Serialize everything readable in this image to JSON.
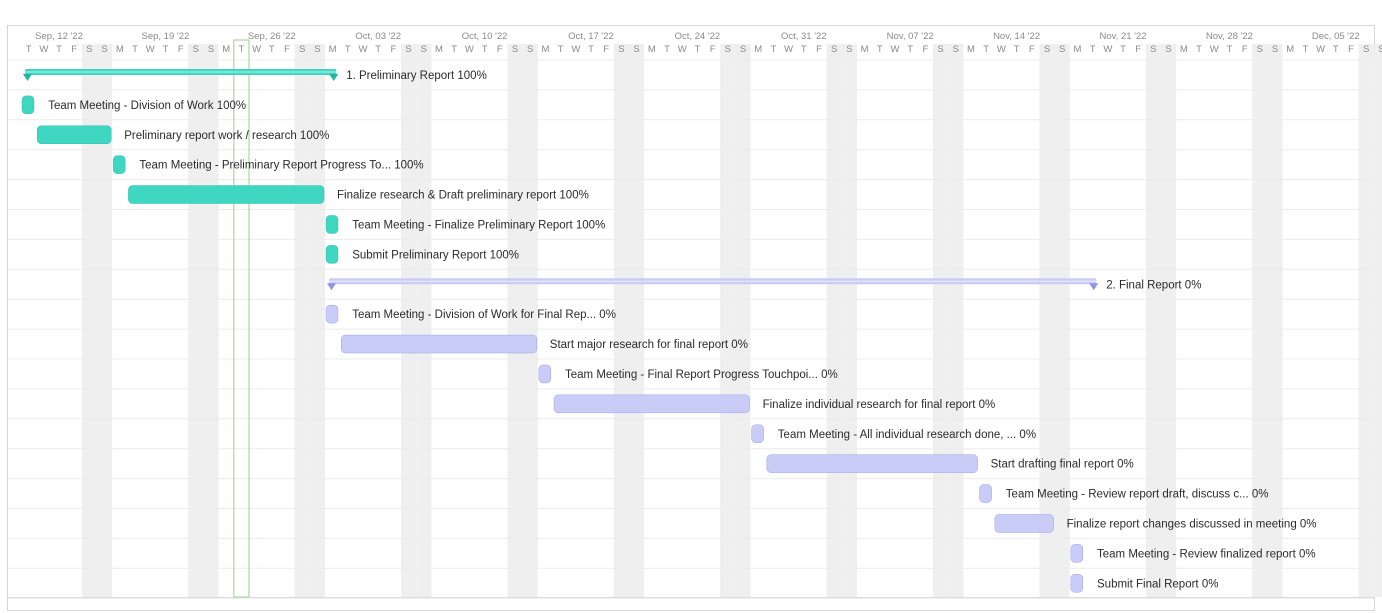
{
  "chart_data": {
    "type": "gantt",
    "x_axis": {
      "start": "2022-09-13",
      "end": "2022-12-11",
      "week_ticks": [
        "Sep, 12 '22",
        "Sep, 19 '22",
        "Sep, 26 '22",
        "Oct, 03 '22",
        "Oct, 10 '22",
        "Oct, 17 '22",
        "Oct, 24 '22",
        "Oct, 31 '22",
        "Nov, 07 '22",
        "Nov, 14 '22",
        "Nov, 21 '22",
        "Nov, 28 '22",
        "Dec, 05 '22"
      ],
      "week_tick_dates": [
        "2022-09-12",
        "2022-09-19",
        "2022-09-26",
        "2022-10-03",
        "2022-10-10",
        "2022-10-17",
        "2022-10-24",
        "2022-10-31",
        "2022-11-07",
        "2022-11-14",
        "2022-11-21",
        "2022-11-28",
        "2022-12-05"
      ],
      "day_letters": [
        "M",
        "T",
        "W",
        "T",
        "F",
        "S",
        "S"
      ],
      "today": "2022-09-27"
    },
    "colors": {
      "preliminary": "#3fd6c2",
      "preliminary_dark": "#22b5a4",
      "final": "#c9ccf6",
      "final_dark": "#8f94e6",
      "weekend": "#efefef",
      "today_outline": "#a9d89a"
    },
    "tasks": [
      {
        "label": "1. Preliminary Report 100%",
        "start": "2022-09-13",
        "end": "2022-10-04",
        "kind": "group",
        "group": "preliminary",
        "progress": 100
      },
      {
        "label": "Team Meeting - Division of Work 100%",
        "start": "2022-09-13",
        "end": "2022-09-14",
        "kind": "task",
        "group": "preliminary",
        "progress": 100
      },
      {
        "label": "Preliminary report work / research 100%",
        "start": "2022-09-14",
        "end": "2022-09-19",
        "kind": "task",
        "group": "preliminary",
        "progress": 100
      },
      {
        "label": "Team Meeting - Preliminary Report Progress To... 100%",
        "start": "2022-09-19",
        "end": "2022-09-20",
        "kind": "task",
        "group": "preliminary",
        "progress": 100
      },
      {
        "label": "Finalize research & Draft preliminary report 100%",
        "start": "2022-09-20",
        "end": "2022-10-03",
        "kind": "task",
        "group": "preliminary",
        "progress": 100
      },
      {
        "label": "Team Meeting - Finalize Preliminary Report 100%",
        "start": "2022-10-03",
        "end": "2022-10-04",
        "kind": "task",
        "group": "preliminary",
        "progress": 100
      },
      {
        "label": "Submit Preliminary Report 100%",
        "start": "2022-10-03",
        "end": "2022-10-04",
        "kind": "task",
        "group": "preliminary",
        "progress": 100
      },
      {
        "label": "2. Final Report 0%",
        "start": "2022-10-03",
        "end": "2022-11-23",
        "kind": "group",
        "group": "final",
        "progress": 0
      },
      {
        "label": "Team Meeting - Division of Work for Final Rep... 0%",
        "start": "2022-10-03",
        "end": "2022-10-04",
        "kind": "task",
        "group": "final",
        "progress": 0
      },
      {
        "label": "Start major research for final report 0%",
        "start": "2022-10-04",
        "end": "2022-10-17",
        "kind": "task",
        "group": "final",
        "progress": 0
      },
      {
        "label": "Team Meeting - Final Report Progress Touchpoi... 0%",
        "start": "2022-10-17",
        "end": "2022-10-18",
        "kind": "task",
        "group": "final",
        "progress": 0
      },
      {
        "label": "Finalize individual research for final report 0%",
        "start": "2022-10-18",
        "end": "2022-10-31",
        "kind": "task",
        "group": "final",
        "progress": 0
      },
      {
        "label": "Team Meeting - All individual research done, ... 0%",
        "start": "2022-10-31",
        "end": "2022-11-01",
        "kind": "task",
        "group": "final",
        "progress": 0
      },
      {
        "label": "Start drafting final report 0%",
        "start": "2022-11-01",
        "end": "2022-11-15",
        "kind": "task",
        "group": "final",
        "progress": 0
      },
      {
        "label": "Team Meeting - Review report draft, discuss c... 0%",
        "start": "2022-11-15",
        "end": "2022-11-16",
        "kind": "task",
        "group": "final",
        "progress": 0
      },
      {
        "label": "Finalize report changes discussed in meeting 0%",
        "start": "2022-11-16",
        "end": "2022-11-20",
        "kind": "task",
        "group": "final",
        "progress": 0
      },
      {
        "label": "Team Meeting - Review finalized report 0%",
        "start": "2022-11-21",
        "end": "2022-11-22",
        "kind": "task",
        "group": "final",
        "progress": 0
      },
      {
        "label": "Submit Final Report 0%",
        "start": "2022-11-21",
        "end": "2022-11-22",
        "kind": "task",
        "group": "final",
        "progress": 0
      }
    ]
  }
}
